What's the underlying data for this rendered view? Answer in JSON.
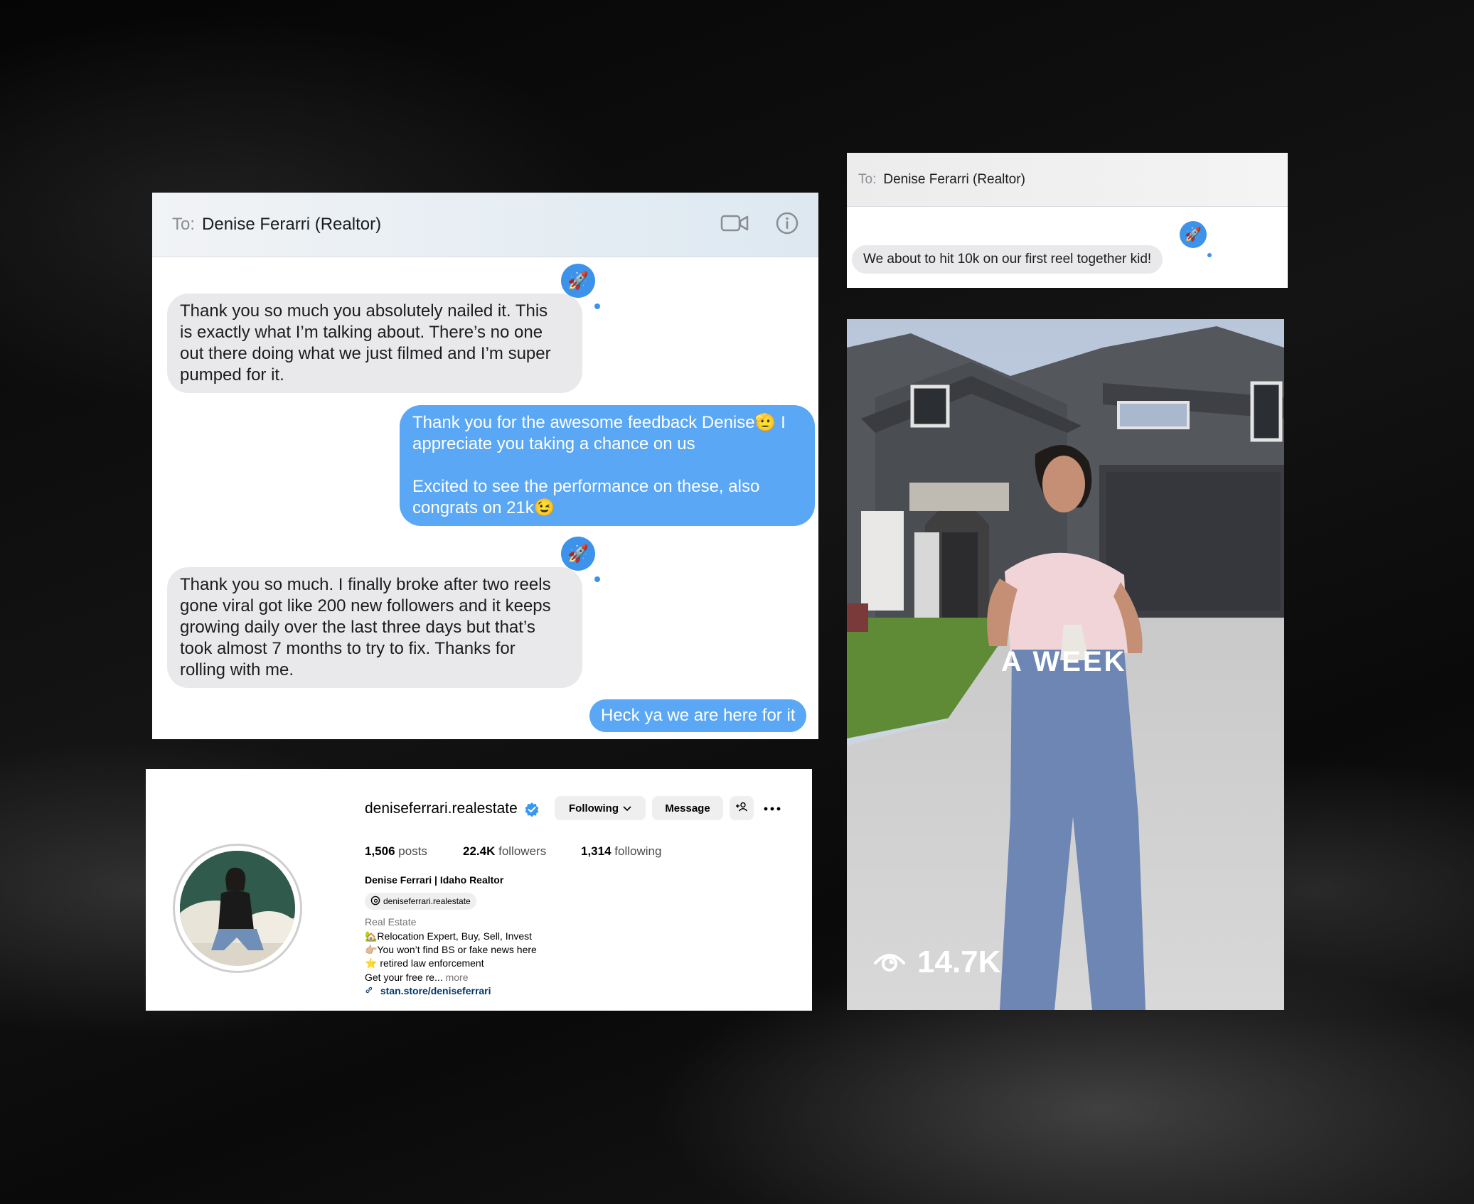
{
  "chat1": {
    "to_label": "To:",
    "to_name": "Denise Ferarri (Realtor)",
    "icons": [
      "video-camera-icon",
      "info-icon"
    ],
    "reaction": "🚀",
    "messages": [
      {
        "dir": "in",
        "lines": [
          "Thank you so much you absolutely nailed it. This",
          "is exactly what I’m talking about. There’s no one",
          "out there doing what we just filmed and I’m super",
          "pumped for it."
        ]
      },
      {
        "dir": "out",
        "lines": [
          "Thank you for the awesome feedback Denise🫡 I",
          "appreciate you taking a chance on us",
          "",
          "Excited to see the performance on these, also",
          "congrats on 21k😉"
        ]
      },
      {
        "dir": "in",
        "lines": [
          "Thank you so much. I finally broke after two reels",
          "gone viral got like 200 new followers and it keeps",
          "growing daily over the last three days but that’s",
          "took almost 7 months to try to fix. Thanks for",
          "rolling with me."
        ]
      },
      {
        "dir": "out",
        "lines": [
          "Heck ya we are here for it"
        ]
      }
    ]
  },
  "chat2": {
    "to_label": "To:",
    "to_name": "Denise Ferarri (Realtor)",
    "reaction": "🚀",
    "message": "We about to hit 10k on our first reel together kid!"
  },
  "profile": {
    "username": "deniseferrari.realestate",
    "verified": true,
    "following_label": "Following",
    "message_label": "Message",
    "posts_count": "1,506",
    "posts_label": "posts",
    "followers_count": "22.4K",
    "followers_label": "followers",
    "following_count": "1,314",
    "following_stat_label": "following",
    "display_name": "Denise Ferrari | Idaho Realtor",
    "threads_handle": "deniseferrari.realestate",
    "category": "Real Estate",
    "bio_lines": [
      "🏡Relocation Expert, Buy, Sell, Invest",
      "👉🏼You won’t find BS or fake news here",
      "⭐ retired law enforcement"
    ],
    "bio_truncated": "Get your free re...",
    "more_label": "more",
    "link": "stan.store/deniseferrari"
  },
  "reel": {
    "overlay_text": "A WEEK",
    "views": "14.7K",
    "views_icon": "eye-icon"
  },
  "colors": {
    "imessage_blue": "#5aa7f5",
    "incoming_gray": "#e9e9eb",
    "reaction_blue": "#3d92ea",
    "verified_blue": "#3897f0",
    "link_navy": "#00376b"
  }
}
